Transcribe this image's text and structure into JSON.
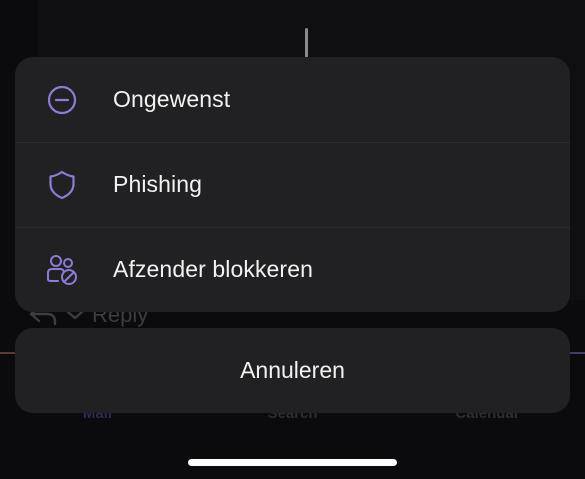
{
  "background": {
    "reply_label": "Reply",
    "tabs": [
      {
        "label": "Mail"
      },
      {
        "label": "Search"
      },
      {
        "label": "Calendar"
      }
    ]
  },
  "action_sheet": {
    "items": [
      {
        "label": "Ongewenst",
        "icon": "minus-circle-icon"
      },
      {
        "label": "Phishing",
        "icon": "shield-icon"
      },
      {
        "label": "Afzender blokkeren",
        "icon": "block-people-icon"
      }
    ],
    "cancel_label": "Annuleren"
  },
  "colors": {
    "accent": "#8f7bd6",
    "sheet_bg": "#212123",
    "text": "#f2f2f2"
  }
}
